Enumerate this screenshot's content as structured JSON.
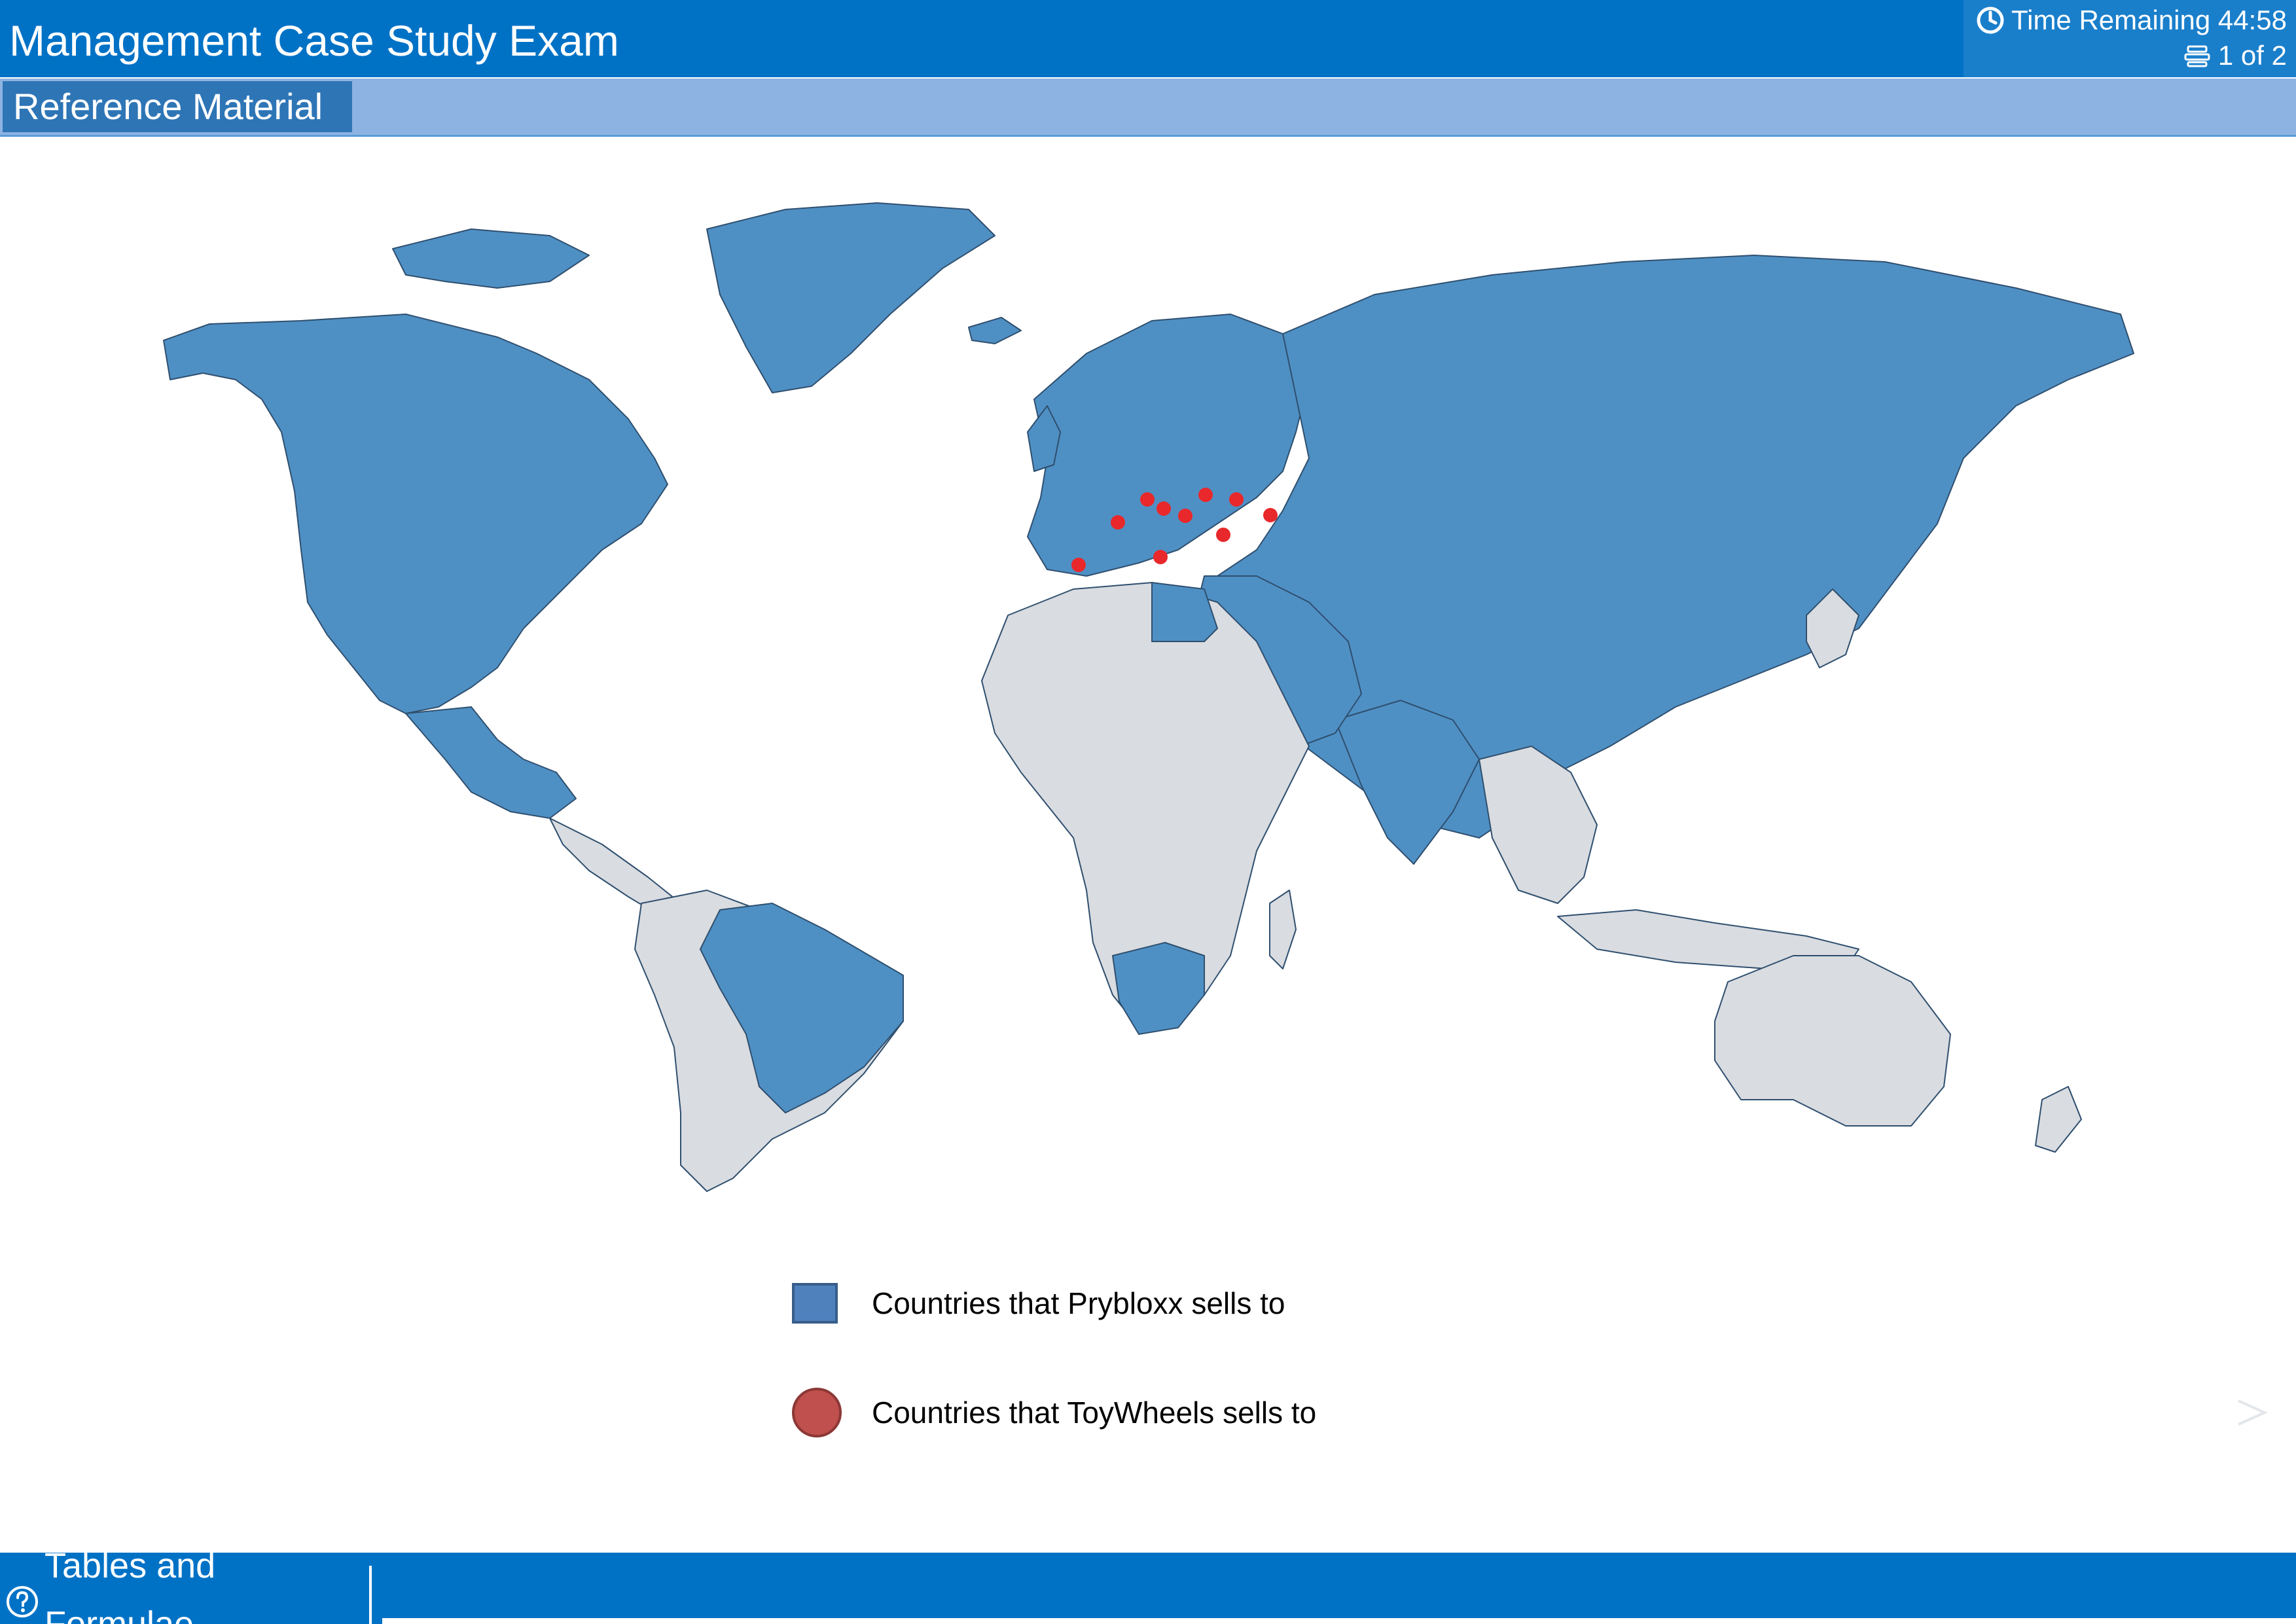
{
  "header": {
    "title": "Management Case Study Exam",
    "timer_label": "Time Remaining 44:58",
    "pager_label": "1 of 2",
    "timer_icon": "clock-icon",
    "pager_icon": "pages-icon"
  },
  "subheader": {
    "tab_label": "Reference Material"
  },
  "map": {
    "prybloxx_color": "#4F90C4",
    "other_color": "#D9DCE0",
    "toywheels_color": "#E8282B"
  },
  "legend": {
    "prybloxx_label": "Countries that Prybloxx sells to",
    "toywheels_label": "Countries that ToyWheels sells to",
    "prybloxx_swatch": "#4F81BD",
    "toywheels_swatch": "#C0504D"
  },
  "footer": {
    "tables_label": "Tables and Formulae",
    "tables_icon": "help-icon"
  },
  "colors": {
    "header_bg": "#0072C6",
    "subbar_bg": "#8DB3E2",
    "tab_bg": "#2E75B6"
  }
}
